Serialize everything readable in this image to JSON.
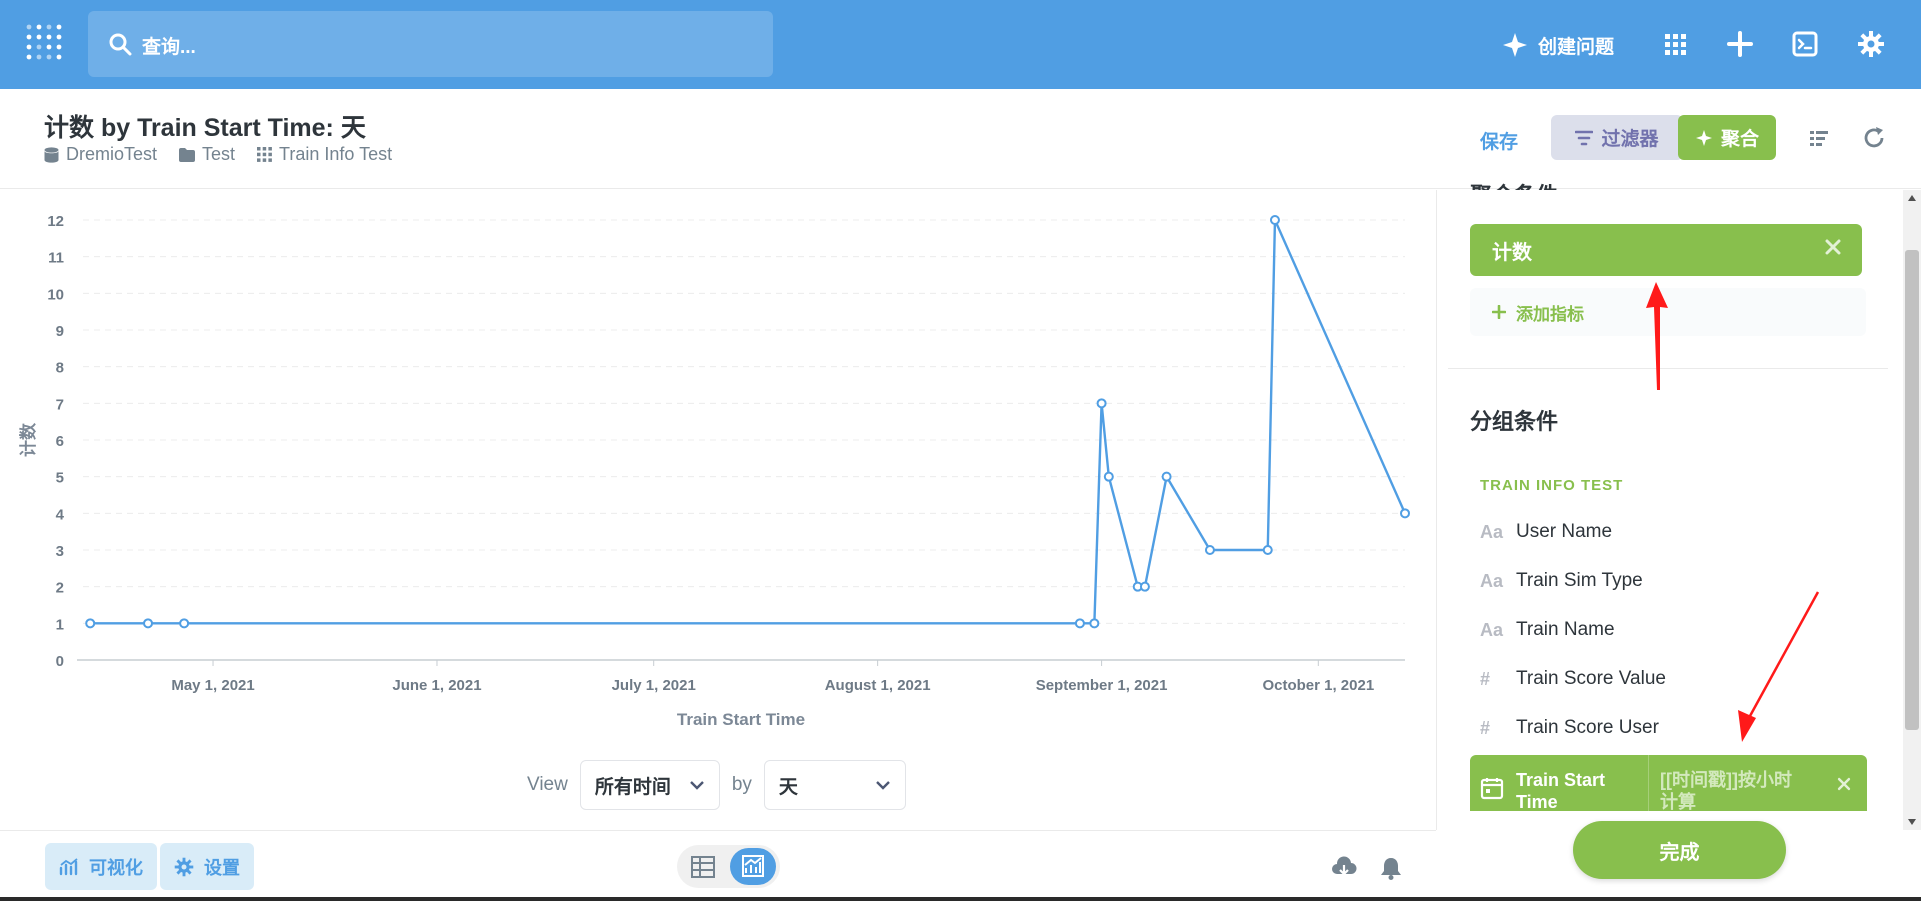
{
  "nav": {
    "search_placeholder": "查询...",
    "new_question_label": "创建问题",
    "icons": [
      "sparkle-icon",
      "apps-grid-icon",
      "plus-icon",
      "terminal-icon",
      "gear-icon"
    ]
  },
  "header": {
    "title": "计数 by Train Start Time: 天",
    "breadcrumbs": [
      {
        "icon": "database-icon",
        "label": "DremioTest"
      },
      {
        "icon": "folder-icon",
        "label": "Test"
      },
      {
        "icon": "table-grid-icon",
        "label": "Train Info Test"
      }
    ],
    "save_label": "保存",
    "filter_label": "过滤器",
    "summarize_label": "聚合"
  },
  "chart_data": {
    "type": "line",
    "xlabel": "Train Start Time",
    "ylabel": "计数",
    "ylim": [
      0,
      12
    ],
    "yticks": [
      "0",
      "1",
      "2",
      "3",
      "4",
      "5",
      "6",
      "7",
      "8",
      "9",
      "10",
      "11",
      "12"
    ],
    "xticks": [
      "May 1, 2021",
      "June 1, 2021",
      "July 1, 2021",
      "August 1, 2021",
      "September 1, 2021",
      "October 1, 2021"
    ],
    "xrange": [
      "2021-04-13",
      "2021-10-13"
    ],
    "color": "#509ee3",
    "grid": "horizontal dashed",
    "series": [
      {
        "points": [
          {
            "x": "2021-04-14",
            "y": 1
          },
          {
            "x": "2021-04-22",
            "y": 1
          },
          {
            "x": "2021-04-27",
            "y": 1
          },
          {
            "x": "2021-08-29",
            "y": 1
          },
          {
            "x": "2021-08-31",
            "y": 1
          },
          {
            "x": "2021-09-01",
            "y": 7
          },
          {
            "x": "2021-09-02",
            "y": 5
          },
          {
            "x": "2021-09-06",
            "y": 2
          },
          {
            "x": "2021-09-07",
            "y": 2
          },
          {
            "x": "2021-09-10",
            "y": 5
          },
          {
            "x": "2021-09-16",
            "y": 3
          },
          {
            "x": "2021-09-24",
            "y": 3
          },
          {
            "x": "2021-09-25",
            "y": 12
          },
          {
            "x": "2021-10-13",
            "y": 4
          }
        ]
      }
    ]
  },
  "view_controls": {
    "view_label": "View",
    "period_value": "所有时间",
    "by_label": "by",
    "unit_value": "天"
  },
  "footer": {
    "visualize_label": "可视化",
    "settings_label": "设置"
  },
  "sidebar": {
    "metrics_heading": "聚合条件",
    "metric_label": "计数",
    "add_metric_label": "添加指标",
    "groupby_heading": "分组条件",
    "table_name": "TRAIN INFO TEST",
    "fields": [
      {
        "icon": "Aa",
        "label": "User Name"
      },
      {
        "icon": "Aa",
        "label": "Train Sim Type"
      },
      {
        "icon": "Aa",
        "label": "Train Name"
      },
      {
        "icon": "#",
        "label": "Train Score Value"
      },
      {
        "icon": "#",
        "label": "Train Score User"
      }
    ],
    "selected_field": {
      "label": "Train Start Time",
      "bucket": "[[时间戳]]按小时计算"
    },
    "done_label": "完成"
  },
  "annotation_color": "#ff1a1a"
}
